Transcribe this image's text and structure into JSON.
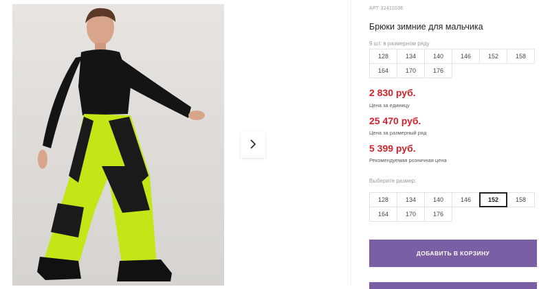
{
  "product": {
    "article": "АРТ 32411036",
    "title": "Брюки зимние для мальчика",
    "pack_note": "9 шт. в размерном ряду",
    "pack_sizes": [
      "128",
      "134",
      "140",
      "146",
      "152",
      "158",
      "164",
      "170",
      "176"
    ],
    "prices": [
      {
        "value": "2 830 руб.",
        "label": "Цена за единицу"
      },
      {
        "value": "25 470 руб.",
        "label": "Цена за размерный ряд"
      },
      {
        "value": "5 399 руб.",
        "label": "Рекомендуемая розничная цена"
      }
    ],
    "choose_label": "Выберите размер:",
    "size_options": [
      "128",
      "134",
      "140",
      "146",
      "152",
      "158",
      "164",
      "170",
      "176"
    ],
    "selected_size": "152",
    "add_to_cart": "ДОБАВИТЬ В КОРЗИНУ"
  },
  "gallery": {
    "image_alt_icon": "product-photo",
    "next_icon": "chevron-right-icon"
  },
  "colors": {
    "accent": "#7b5fa4",
    "price": "#d4232b",
    "pants_green": "#c4e617"
  }
}
